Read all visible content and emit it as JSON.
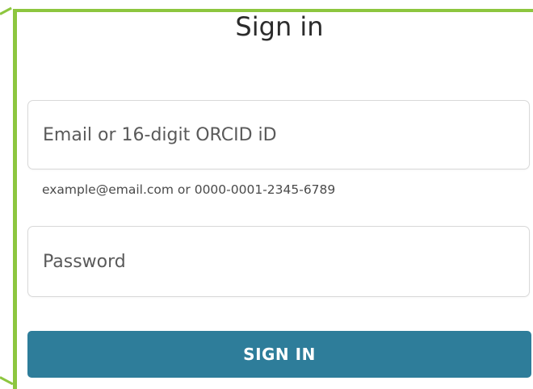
{
  "page": {
    "title": "Sign in"
  },
  "email_field": {
    "placeholder": "Email or 16-digit ORCID iD",
    "value": "",
    "hint": "example@email.com or 0000-0001-2345-6789"
  },
  "password_field": {
    "placeholder": "Password",
    "value": ""
  },
  "signin_button": {
    "label": "SIGN IN"
  },
  "colors": {
    "highlight_frame": "#8dc63f",
    "button_background": "#2e7d9a",
    "button_text": "#ffffff",
    "field_border": "#d9d9d9"
  }
}
